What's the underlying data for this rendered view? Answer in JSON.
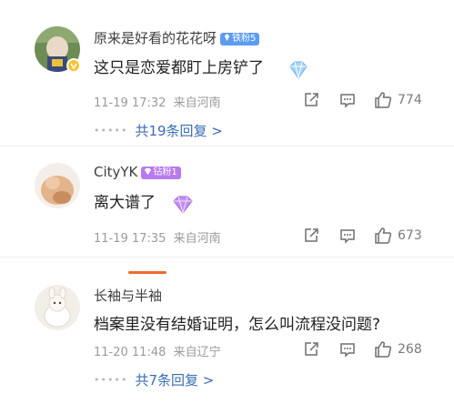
{
  "comments": [
    {
      "username": "原来是好看的花花呀",
      "fan_badge": "铁粉5",
      "text": "这只是恋爱都盯上房铲了",
      "timestamp": "11-19 17:32",
      "location": "来自河南",
      "like_count": "774",
      "replies_label": "共19条回复 >"
    },
    {
      "username": "CityYK",
      "fan_badge": "钻粉1",
      "text": "离大谱了",
      "timestamp": "11-19 17:35",
      "location": "来自河南",
      "like_count": "673"
    },
    {
      "username": "长袖与半袖",
      "text": "档案里没有结婚证明，怎么叫流程没问题?",
      "timestamp": "11-20 11:48",
      "location": "来自辽宁",
      "like_count": "268",
      "replies_label": "共7条回复 >"
    }
  ],
  "colors": {
    "accent_link": "#3b6cb5",
    "fan_blue": "#5d9bf3",
    "fan_purple": "#b87af0",
    "vip_gold": "#f7c42f",
    "tab_indicator": "#f06a2a"
  },
  "icons": [
    "share-icon",
    "comment-icon",
    "like-icon",
    "diamond-emoji-icon",
    "verified-v-icon"
  ]
}
